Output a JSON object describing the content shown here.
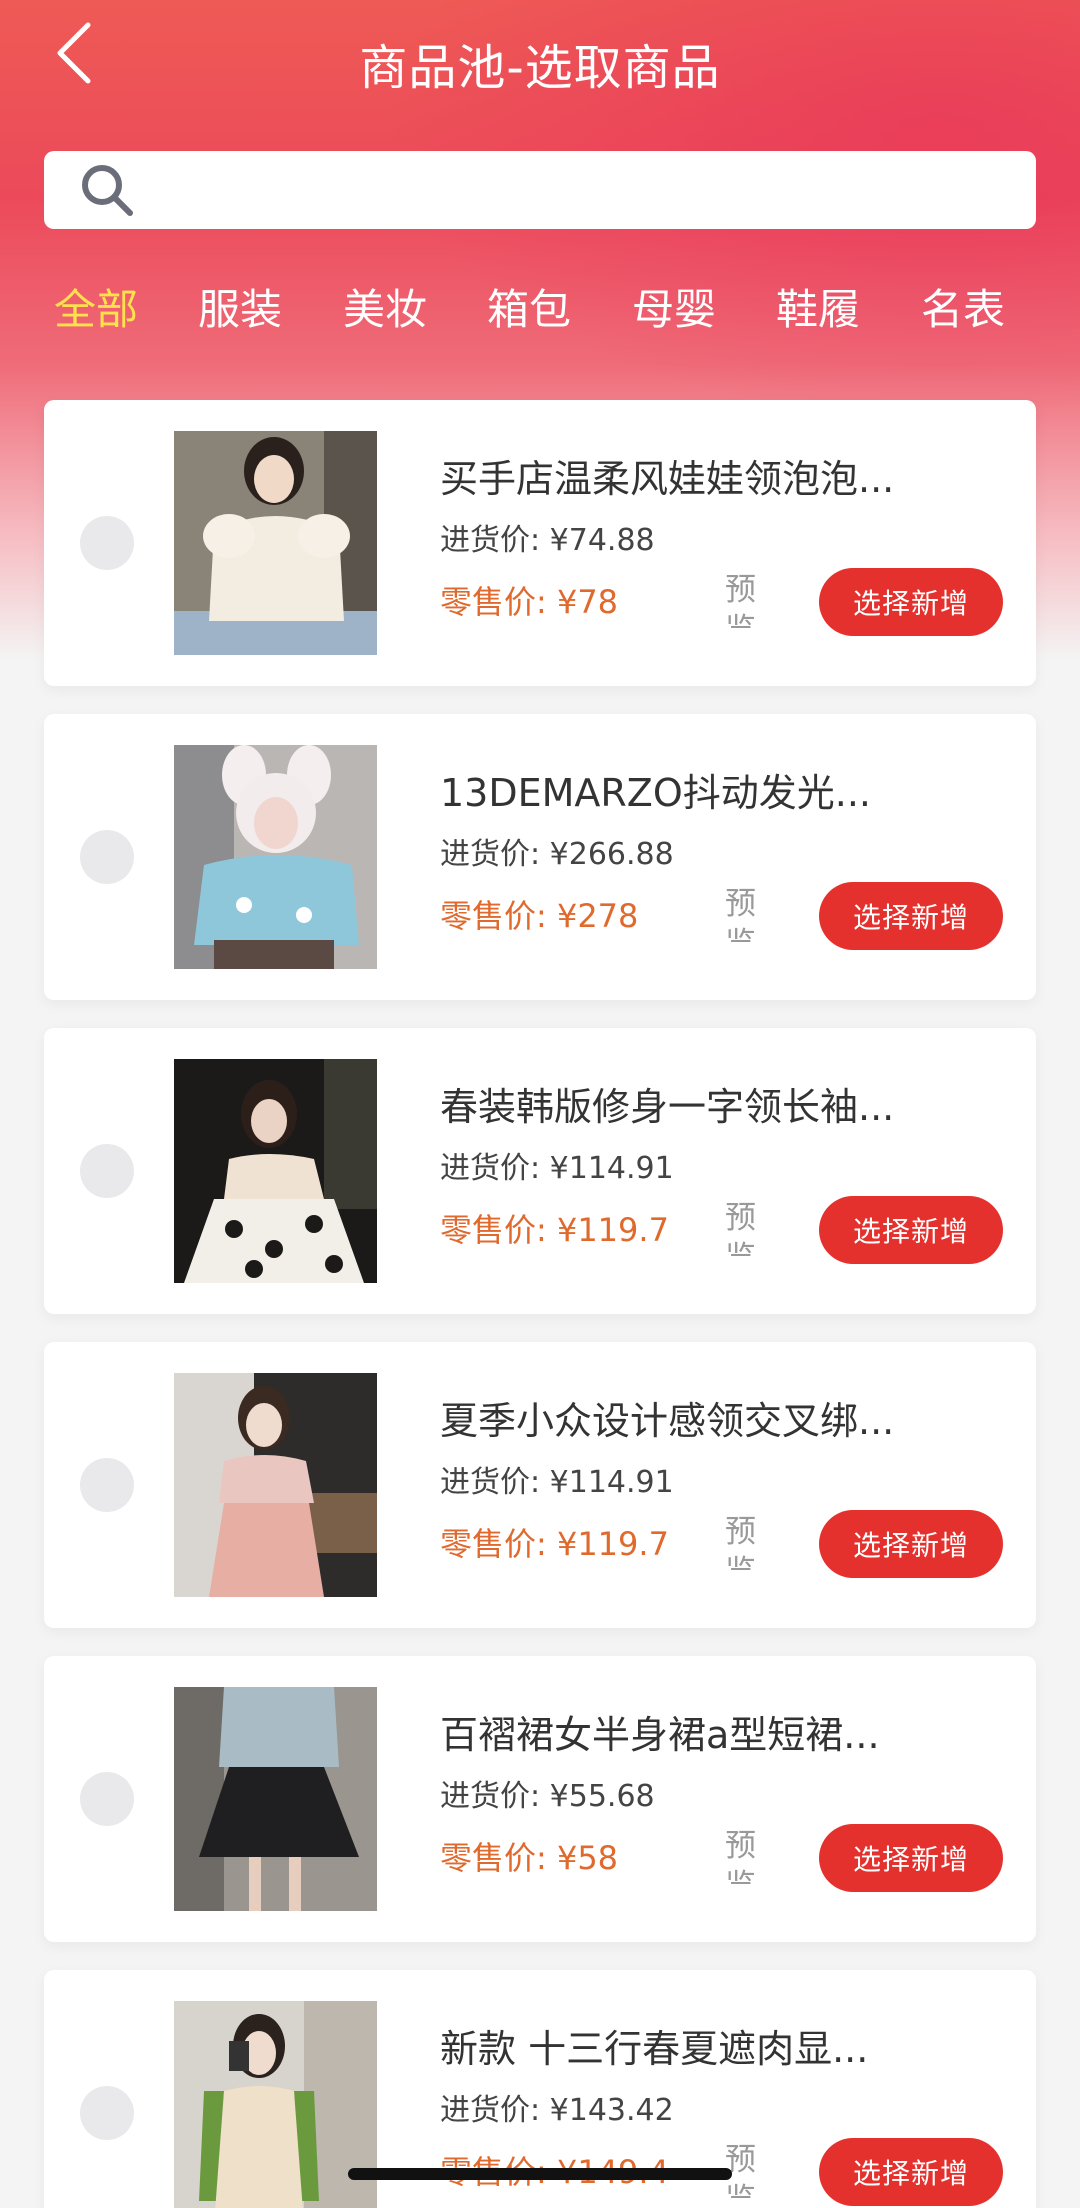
{
  "header": {
    "title": "商品池-选取商品",
    "back_icon": "chevron-left-icon"
  },
  "search": {
    "placeholder": "",
    "value": "",
    "icon": "search-icon"
  },
  "tabs": [
    {
      "label": "全部",
      "active": true
    },
    {
      "label": "服装",
      "active": false
    },
    {
      "label": "美妆",
      "active": false
    },
    {
      "label": "箱包",
      "active": false
    },
    {
      "label": "母婴",
      "active": false
    },
    {
      "label": "鞋履",
      "active": false
    },
    {
      "label": "名表",
      "active": false
    }
  ],
  "products": [
    {
      "name": "买手店温柔风娃娃领泡泡...",
      "cost": "进货价: ¥74.88",
      "retail": "零售价: ¥78",
      "preview": "预览",
      "button": "选择新增",
      "selected": false
    },
    {
      "name": "13DEMARZO抖动发光...",
      "cost": "进货价: ¥266.88",
      "retail": "零售价: ¥278",
      "preview": "预览",
      "button": "选择新增",
      "selected": false
    },
    {
      "name": "春装韩版修身一字领长袖...",
      "cost": "进货价: ¥114.91",
      "retail": "零售价: ¥119.7",
      "preview": "预览",
      "button": "选择新增",
      "selected": false
    },
    {
      "name": "夏季小众设计感领交叉绑...",
      "cost": "进货价: ¥114.91",
      "retail": "零售价: ¥119.7",
      "preview": "预览",
      "button": "选择新增",
      "selected": false
    },
    {
      "name": "百褶裙女半身裙a型短裙...",
      "cost": "进货价: ¥55.68",
      "retail": "零售价: ¥58",
      "preview": "预览",
      "button": "选择新增",
      "selected": false
    },
    {
      "name": "新款 十三行春夏遮肉显...",
      "cost": "进货价: ¥143.42",
      "retail": "零售价: ¥149.4",
      "preview": "预览",
      "button": "选择新增",
      "selected": false
    }
  ],
  "colors": {
    "header_red": "#ec4a5a",
    "active_tab": "#ffe14d",
    "button_red": "#e5312d",
    "retail_orange": "#e06a2d"
  }
}
